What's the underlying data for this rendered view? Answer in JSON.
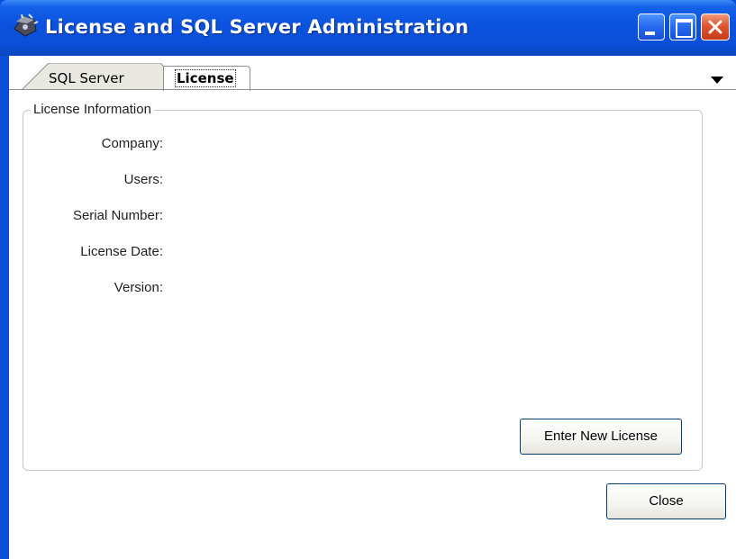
{
  "window": {
    "title": "License and SQL Server Administration",
    "icon": "app-icon",
    "controls": {
      "minimize": "minimize-icon",
      "maximize": "maximize-icon",
      "close": "close-icon"
    }
  },
  "tabs": [
    {
      "label": "SQL Server",
      "active": false
    },
    {
      "label": "License",
      "active": true
    }
  ],
  "tab_overflow_icon": "dropdown-arrow-icon",
  "license_info": {
    "group_title": "License Information",
    "fields": [
      {
        "label": "Company:",
        "value": ""
      },
      {
        "label": "Users:",
        "value": ""
      },
      {
        "label": "Serial Number:",
        "value": ""
      },
      {
        "label": "License Date:",
        "value": ""
      },
      {
        "label": "Version:",
        "value": ""
      }
    ],
    "enter_button": "Enter New License"
  },
  "footer": {
    "close_button": "Close"
  },
  "colors": {
    "titlebar": "#0a52de",
    "close_button": "#e0552f",
    "border": "#0b4fd8"
  }
}
